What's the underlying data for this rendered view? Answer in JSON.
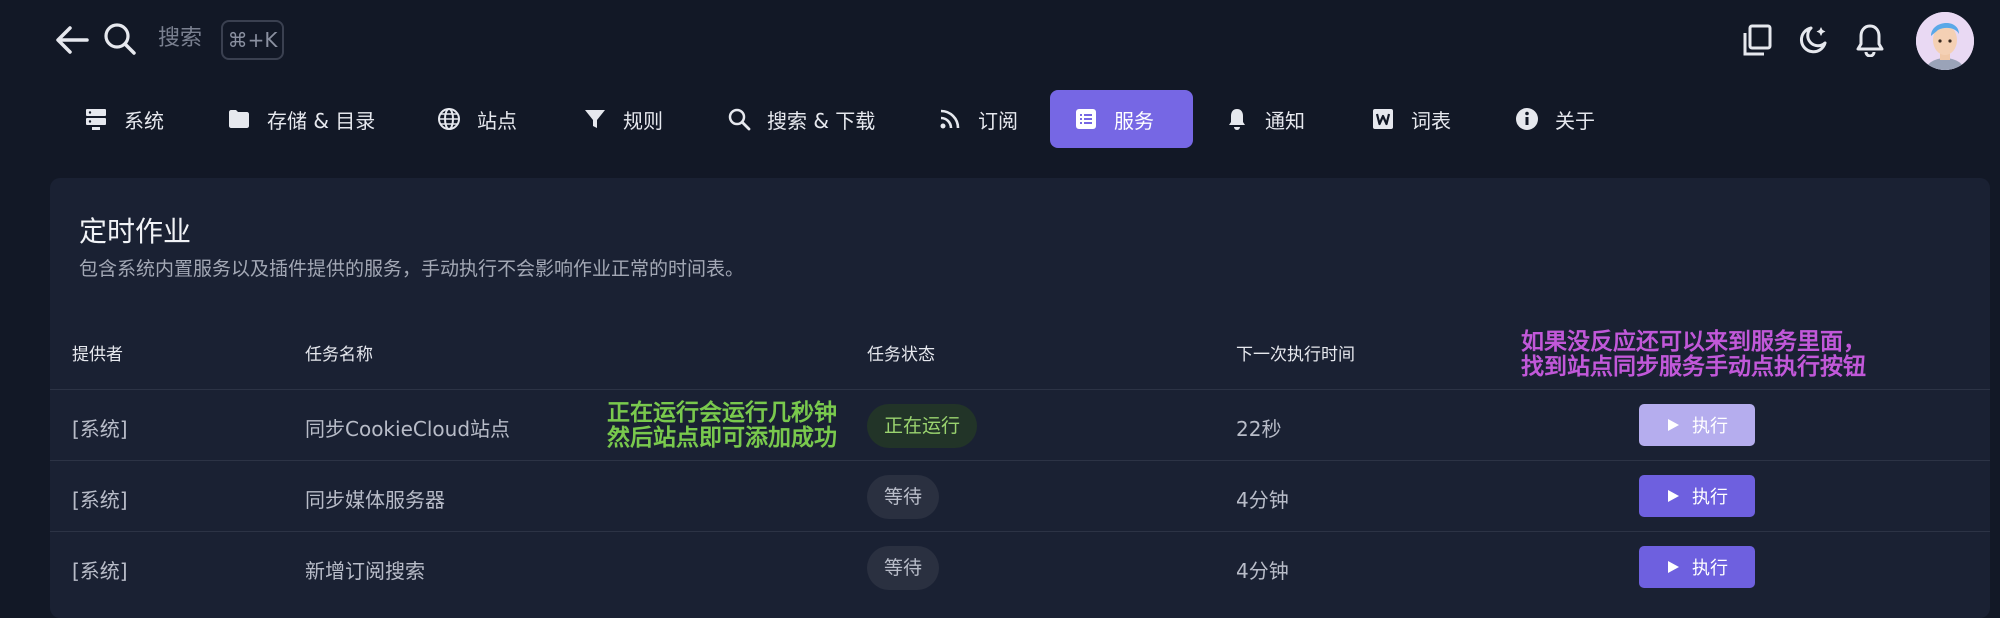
{
  "header": {
    "search_placeholder": "搜索",
    "shortcut": "⌘+K",
    "icons": [
      "back-arrow-icon",
      "search-icon",
      "copy-window-icon",
      "moon-star-icon",
      "bell-icon",
      "avatar"
    ]
  },
  "tabs": [
    {
      "label": "系统",
      "icon": "server-icon"
    },
    {
      "label": "存储 & 目录",
      "icon": "folder-icon"
    },
    {
      "label": "站点",
      "icon": "globe-icon"
    },
    {
      "label": "规则",
      "icon": "filter-icon"
    },
    {
      "label": "搜索 & 下载",
      "icon": "search-icon"
    },
    {
      "label": "订阅",
      "icon": "rss-icon"
    },
    {
      "label": "服务",
      "icon": "list-icon",
      "active": true
    },
    {
      "label": "通知",
      "icon": "bell-icon"
    },
    {
      "label": "词表",
      "icon": "word-icon"
    },
    {
      "label": "关于",
      "icon": "info-icon"
    }
  ],
  "card": {
    "title": "定时作业",
    "subtitle": "包含系统内置服务以及插件提供的服务，手动执行不会影响作业正常的时间表。"
  },
  "table": {
    "headers": [
      "提供者",
      "任务名称",
      "任务状态",
      "下一次执行时间"
    ],
    "rows": [
      {
        "provider": "[系统]",
        "name": "同步CookieCloud站点",
        "status": "正在运行",
        "next": "22秒",
        "action": "执行"
      },
      {
        "provider": "[系统]",
        "name": "同步媒体服务器",
        "status": "等待",
        "next": "4分钟",
        "action": "执行"
      },
      {
        "provider": "[系统]",
        "name": "新增订阅搜索",
        "status": "等待",
        "next": "4分钟",
        "action": "执行"
      }
    ]
  },
  "annotations": {
    "green_line1": "正在运行会运行几秒钟",
    "green_line2": "然后站点即可添加成功",
    "purple_line1": "如果没反应还可以来到服务里面，",
    "purple_line2": "找到站点同步服务手动点执行按钮"
  },
  "colors": {
    "accent": "#7667e4",
    "running": "#9ad36f",
    "note_green": "#79c94d",
    "note_purple": "#c158d9"
  }
}
